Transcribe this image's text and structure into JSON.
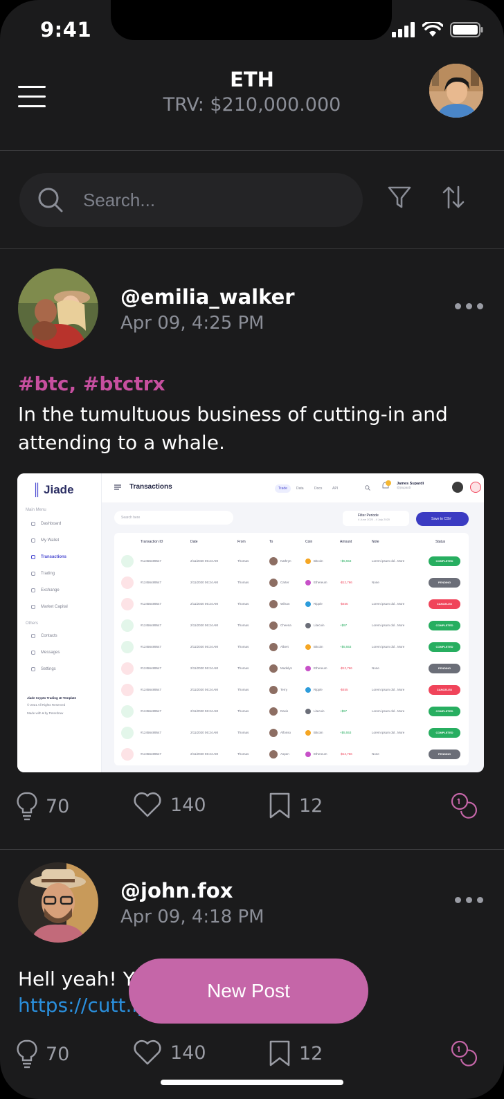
{
  "status": {
    "time": "9:41"
  },
  "header": {
    "title": "ETH",
    "subtitle": "TRV: $210,000.000"
  },
  "search": {
    "placeholder": "Search..."
  },
  "posts": [
    {
      "handle": "@emilia_walker",
      "time": "Apr 09, 4:25 PM",
      "tags": "#btc, #btctrx",
      "text": "In the tumultuous business of cutting-in and attending to a whale.",
      "ideas": "70",
      "likes": "140",
      "saves": "12"
    },
    {
      "handle": "@john.fox",
      "time": "Apr 09, 4:18 PM",
      "text": "Hell yeah! Y",
      "link": "https://cutt.ly/rMTG7Y1",
      "ideas": "70",
      "likes": "140",
      "saves": "12"
    }
  ],
  "embed": {
    "logo": "Jiade",
    "page_title": "Transactions",
    "tabs": [
      "Trade",
      "Data",
      "Docs",
      "API"
    ],
    "user_name": "James Supardi",
    "user_handle": "@jsupardi",
    "search_placeholder": "Search here",
    "filter_label": "Filter Periode",
    "filter_range": "4 June 2020 - 4 July 2020",
    "csv_label": "Save to CSV",
    "menu_section": "Main Menu",
    "other_section": "Others",
    "nav": [
      "Dashboard",
      "My Wallet",
      "Transactions",
      "Trading",
      "Exchange",
      "Market Capital"
    ],
    "nav_other": [
      "Contacts",
      "Messages",
      "Settings"
    ],
    "footer_title": "Jiade Crypto Trading UI Template",
    "footer_copy": "© 2021 All Rights Reserved",
    "footer_made": "Made with ♥ by Peterdraw",
    "columns": [
      "Transaction ID",
      "Date",
      "From",
      "To",
      "Coin",
      "Amount",
      "Note",
      "Status"
    ],
    "rows": [
      {
        "dir": "in",
        "id": "#12456489547",
        "date": "2/11/2020 06:24 AM",
        "from": "Thomas",
        "to": "Kathryn",
        "coin": "Bitcoin",
        "amount": "+$5,553",
        "note": "Lorem ipsum dol.. More",
        "status": "COMPLETED"
      },
      {
        "dir": "out",
        "id": "#12456489547",
        "date": "2/11/2020 06:24 AM",
        "from": "Thomas",
        "to": "Carter",
        "coin": "Ethereum",
        "amount": "-$12,766",
        "note": "None",
        "status": "PENDING"
      },
      {
        "dir": "out",
        "id": "#12456489547",
        "date": "2/11/2020 06:24 AM",
        "from": "Thomas",
        "to": "Wilson",
        "coin": "Ripple",
        "amount": "-$455",
        "note": "Lorem ipsum dol.. More",
        "status": "CANCELED"
      },
      {
        "dir": "in",
        "id": "#12456489547",
        "date": "2/11/2020 06:24 AM",
        "from": "Thomas",
        "to": "Cheena",
        "coin": "Litecoin",
        "amount": "+$97",
        "note": "Lorem ipsum dol.. More",
        "status": "COMPLETED"
      },
      {
        "dir": "in",
        "id": "#12456489547",
        "date": "2/11/2020 06:24 AM",
        "from": "Thomas",
        "to": "Albert",
        "coin": "Bitcoin",
        "amount": "+$5,553",
        "note": "Lorem ipsum dol.. More",
        "status": "COMPLETED"
      },
      {
        "dir": "out",
        "id": "#12456489547",
        "date": "2/11/2020 06:24 AM",
        "from": "Thomas",
        "to": "Madelyn",
        "coin": "Ethereum",
        "amount": "-$12,766",
        "note": "None",
        "status": "PENDING"
      },
      {
        "dir": "out",
        "id": "#12456489547",
        "date": "2/11/2020 06:24 AM",
        "from": "Thomas",
        "to": "Terry",
        "coin": "Ripple",
        "amount": "-$455",
        "note": "Lorem ipsum dol.. More",
        "status": "CANCELED"
      },
      {
        "dir": "in",
        "id": "#12456489547",
        "date": "2/11/2020 06:24 AM",
        "from": "Thomas",
        "to": "Davis",
        "coin": "Litecoin",
        "amount": "+$97",
        "note": "Lorem ipsum dol.. More",
        "status": "COMPLETED"
      },
      {
        "dir": "in",
        "id": "#12456489547",
        "date": "2/11/2020 06:24 AM",
        "from": "Thomas",
        "to": "Alfonso",
        "coin": "Bitcoin",
        "amount": "+$5,553",
        "note": "Lorem ipsum dol.. More",
        "status": "COMPLETED"
      },
      {
        "dir": "out",
        "id": "#12456489547",
        "date": "2/11/2020 06:24 AM",
        "from": "Thomas",
        "to": "Aspen",
        "coin": "Ethereum",
        "amount": "-$12,766",
        "note": "None",
        "status": "PENDING"
      }
    ]
  },
  "new_post_label": "New Post",
  "colors": {
    "background": "#1b1b1c",
    "accent": "#c566a8",
    "hashtag": "#c64f9f",
    "link": "#2a8fdc",
    "muted": "#8b8e97",
    "completed": "#27ae60",
    "pending": "#6b6e78",
    "canceled": "#f0445a"
  },
  "icons": [
    "menu-icon",
    "search-icon",
    "filter-icon",
    "sort-icon",
    "more-icon",
    "lightbulb-icon",
    "heart-icon",
    "bookmark-icon",
    "coins-icon"
  ]
}
